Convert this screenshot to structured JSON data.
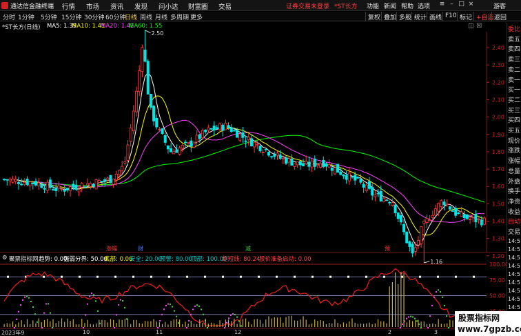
{
  "titlebar": {
    "app_name": "通达信金融终端",
    "menus": [
      "行情",
      "市场",
      "资讯",
      "发现",
      "问小达",
      "财富圈",
      "交易"
    ],
    "login_warning": "证券交易未登录",
    "stock_tag": "*ST长方",
    "right_menus": [
      "功能",
      "新闻",
      "帮助",
      "选项"
    ],
    "guest": "游客"
  },
  "toolbar": {
    "periods": [
      "分时",
      "1分钟",
      "5分钟",
      "15分钟",
      "30分钟",
      "60分钟",
      "日线",
      "周线",
      "月线",
      "多周期",
      "更多"
    ],
    "active_period": "日线",
    "buttons": [
      "复权",
      "叠加",
      "多股",
      "统计",
      "画线",
      "F10",
      "标记",
      "+自选",
      "返回"
    ]
  },
  "main_chart": {
    "stock_label": "*ST长方(日线)",
    "ma5": "MA5: 1.39",
    "ma10": "MA10: 1.41",
    "ma20": "MA20: 1.42",
    "ma60": "MA60: 1.55",
    "high_label": "2.50",
    "low_label": "1.16",
    "price_ticks": [
      "2.40",
      "2.30",
      "2.20",
      "2.10",
      "2.00",
      "1.90",
      "1.80",
      "1.70",
      "1.60",
      "1.50",
      "1.40",
      "1.30",
      "1.20"
    ],
    "markers": [
      {
        "label": "涨幅",
        "color": "#ff3c3c"
      },
      {
        "label": "财",
        "color": "#4a7dff"
      },
      {
        "label": "减",
        "color": "#3cd23c"
      },
      {
        "label": "预",
        "color": "#ff3c3c"
      }
    ]
  },
  "indicator": {
    "name": "聚票指标网",
    "trend": "趋势: 0.00",
    "strong_weak": "强弱分界: 50.00",
    "bottom": "底部: 0.00",
    "safe": "安全: 20.00",
    "alert": "预警: 80.00",
    "top": "顶部: 100.00",
    "oversold": "超短线: 80.24",
    "buy_ready": "股价准备启动: 0.00",
    "ticks": [
      "100.00",
      "75.00",
      "50.00",
      "25.00"
    ]
  },
  "dates": [
    "2023年9",
    "10",
    "11",
    "12",
    "2",
    "3"
  ],
  "right_panel": {
    "labels": [
      "委比",
      "卖五",
      "卖四",
      "卖三",
      "卖二",
      "卖一",
      "买一",
      "买二",
      "买三",
      "买四",
      "买五",
      "现价",
      "涨跌",
      "涨幅",
      "总量",
      "外盘",
      "换手",
      "净资",
      "收益",
      "自动",
      "交易"
    ],
    "times": [
      "14:5",
      "14:5",
      "14:5",
      "14:5",
      "14:5",
      "14:5",
      "14:5",
      "14:5",
      "14:5",
      "14:5",
      "14:5",
      "14:5"
    ]
  },
  "watermark": {
    "title": "股票指标网",
    "url": "www.7gpzb.com"
  },
  "colors": {
    "up": "#ff3c3c",
    "down": "#00e5e5",
    "ma5": "#ffffff",
    "ma10": "#ffff00",
    "ma20": "#ff44ff",
    "ma60": "#00ff00"
  }
}
